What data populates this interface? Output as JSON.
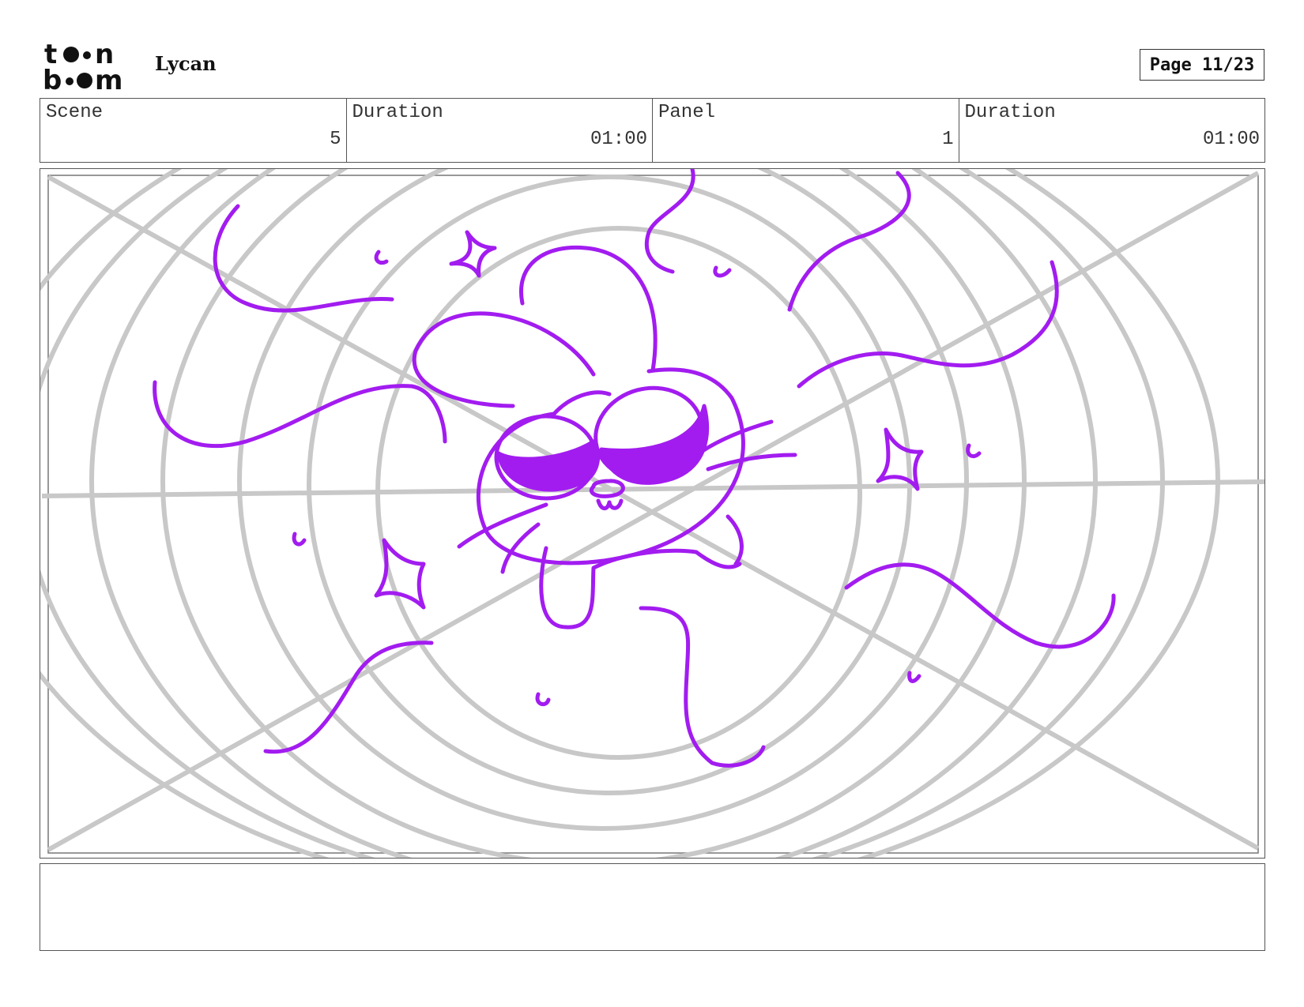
{
  "header": {
    "logo_text": [
      "t",
      "n",
      "b",
      "m"
    ],
    "project_title": "Lycan",
    "page_label": "Page 11/23"
  },
  "info": {
    "scene_label": "Scene",
    "scene_value": "5",
    "scene_duration_label": "Duration",
    "scene_duration_value": "01:00",
    "panel_label": "Panel",
    "panel_value": "1",
    "panel_duration_label": "Duration",
    "panel_duration_value": "01:00"
  },
  "drawing": {
    "guide_color": "#c8c8c8",
    "ink_color": "#a21cf0"
  },
  "notes": {
    "text": ""
  }
}
